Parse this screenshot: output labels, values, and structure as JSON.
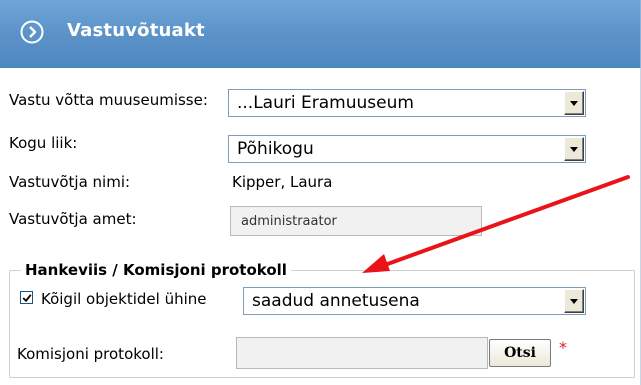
{
  "header": {
    "title": "Vastuvõtuakt",
    "icon": "arrow-right-circle-icon"
  },
  "form": {
    "museum_label": "Vastu võtta muuseumisse:",
    "museum_value": "...Lauri Eramuuseum",
    "collection_label": "Kogu liik:",
    "collection_value": "Põhikogu",
    "receiver_name_label": "Vastuvõtja nimi:",
    "receiver_name_value": "Kipper, Laura",
    "receiver_role_label": "Vastuvõtja amet:",
    "receiver_role_value": "administraator"
  },
  "section": {
    "legend": "Hankeviis / Komisjoni protokoll",
    "checkbox_label": "Kõigil objektidel ühine",
    "checkbox_checked": true,
    "method_value": "saadud annetusena",
    "protocol_label": "Komisjoni protokoll:",
    "protocol_value": "",
    "search_button": "Otsi",
    "required_mark": "*"
  },
  "colors": {
    "header": "#5b93c9",
    "annotation_arrow": "#e8141a",
    "required": "#e02020"
  }
}
